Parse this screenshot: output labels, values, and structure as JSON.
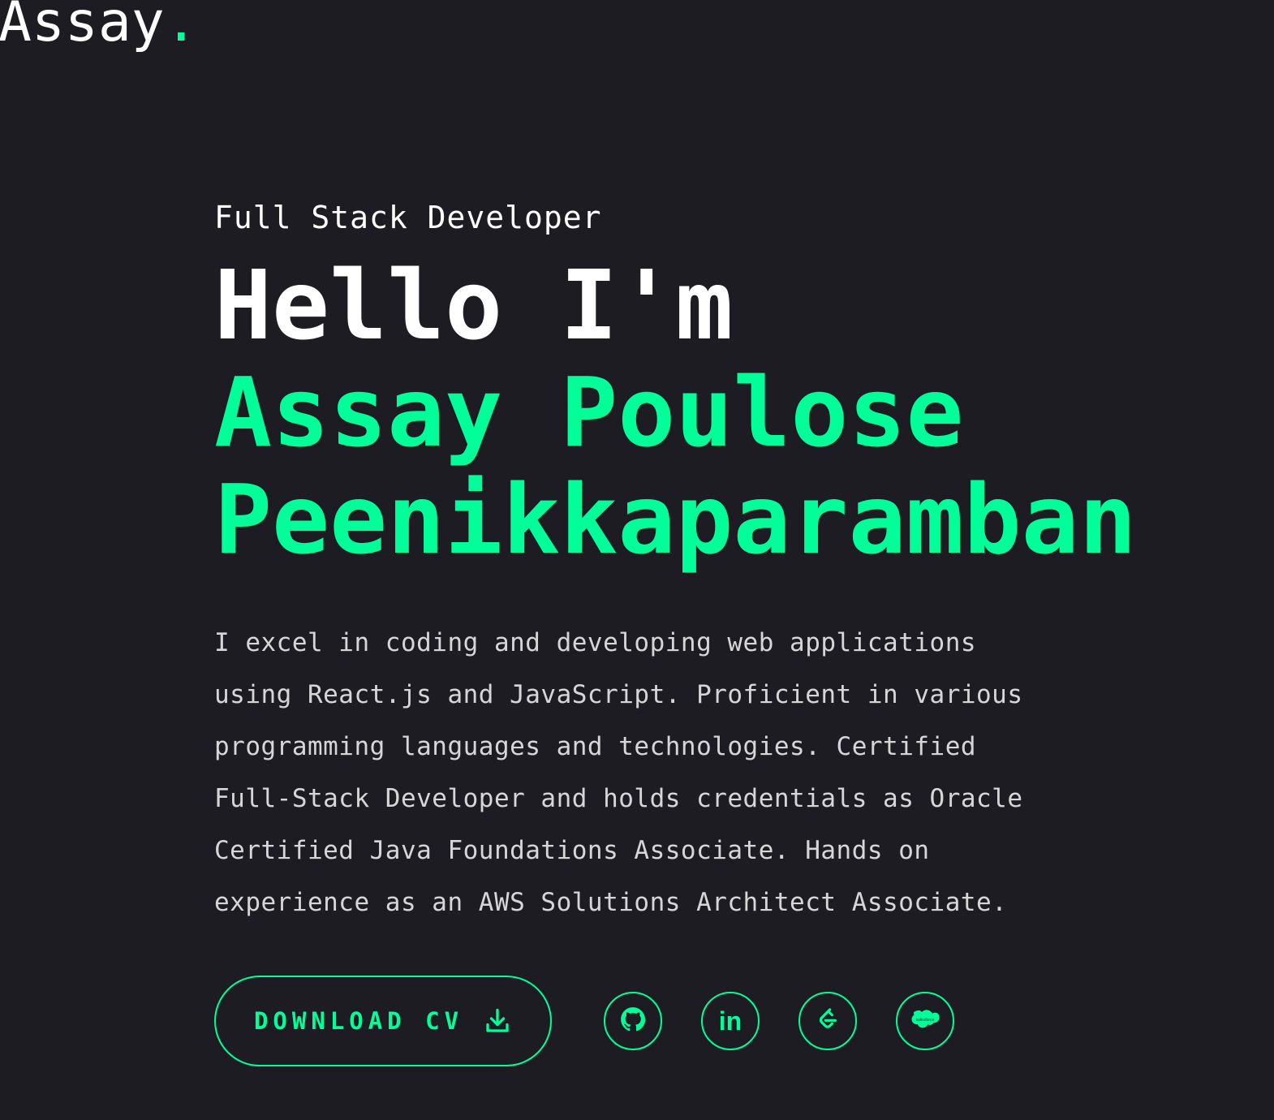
{
  "header": {
    "logo_text": "Assay",
    "logo_dot": "."
  },
  "hero": {
    "role": "Full Stack Developer",
    "greeting": "Hello I'm",
    "name_line1": "Assay Poulose",
    "name_line2": "Peenikkaparamban",
    "description": "I excel in coding and developing web applications using React.js and JavaScript. Proficient in various programming languages and technologies. Certified Full-Stack Developer and holds credentials as Oracle Certified Java Foundations Associate. Hands on experience as an AWS Solutions Architect Associate."
  },
  "actions": {
    "download_cv_label": "Download CV",
    "socials": [
      {
        "name": "GitHub",
        "icon": "github-icon"
      },
      {
        "name": "LinkedIn",
        "icon": "linkedin-icon",
        "text": "in"
      },
      {
        "name": "LeetCode",
        "icon": "leetcode-icon"
      },
      {
        "name": "Salesforce",
        "icon": "salesforce-icon"
      }
    ]
  },
  "colors": {
    "background": "#1c1c22",
    "accent": "#00ff99",
    "text": "#ffffff"
  }
}
